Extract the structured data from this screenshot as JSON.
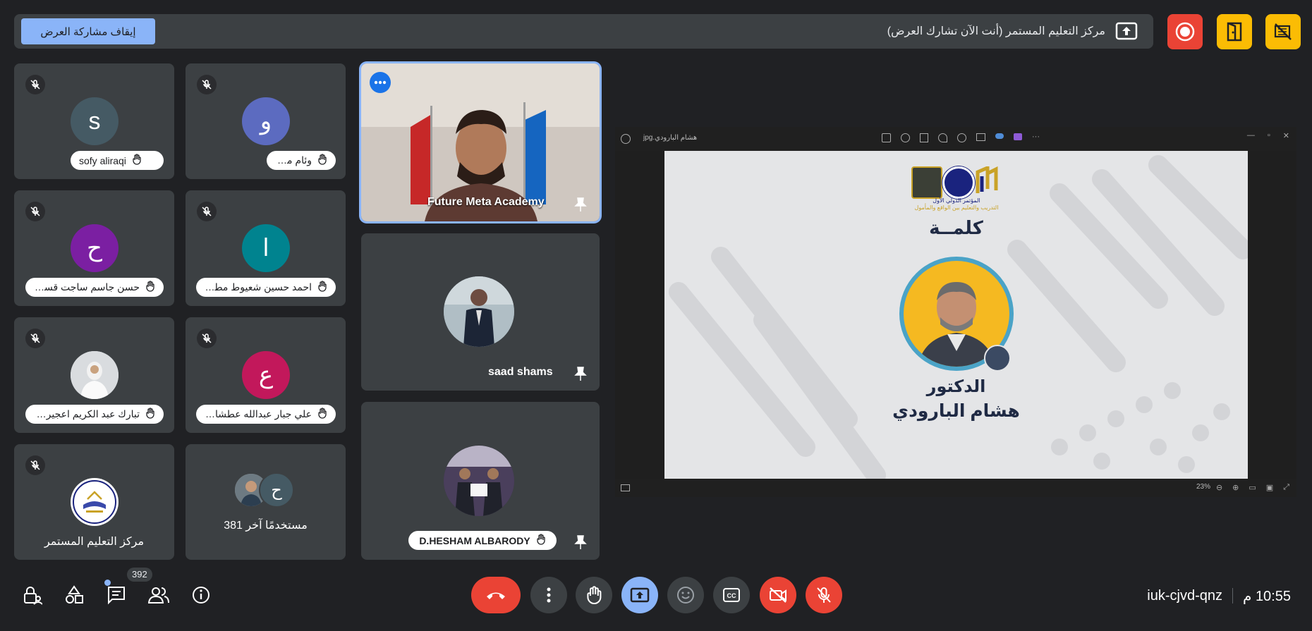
{
  "banner": {
    "stop_share_label": "إيقاف مشاركة العرض",
    "presenting_text": "مركز التعليم المستمر (أنت الآن تشارك العرض)"
  },
  "participants": [
    {
      "name": "sofy aliraqi",
      "initial": "s",
      "color": "#455a64"
    },
    {
      "name": "وئام مراد",
      "initial": "و",
      "color": "#5c6bc0"
    },
    {
      "name": "حسن جاسم ساجت قسم الاد...",
      "initial": "ح",
      "color": "#7b1fa2"
    },
    {
      "name": "احمد حسين شعيوط مطرود ...",
      "initial": "ا",
      "color": "#00838f"
    },
    {
      "name": "تبارك عبد الكريم اعجيري ...",
      "initial": "",
      "color": "#9e9e9e"
    },
    {
      "name": "علي جبار عبدالله عطشان ...",
      "initial": "ع",
      "color": "#c2185b"
    },
    {
      "name": "مركز التعليم المستمر",
      "initial": "",
      "color": "#ffffff"
    },
    {
      "name": "381 مستخدمًا آخر",
      "initial": "ح",
      "color": "#455a64"
    }
  ],
  "featured": [
    {
      "name": "Future Meta Academy"
    },
    {
      "name": "saad shams"
    },
    {
      "name": "D.HESHAM ALBARODY"
    }
  ],
  "presentation": {
    "window_title": "هشام البارودي.jpg",
    "zoom": "23%",
    "slide_heading": "كلمــة",
    "speaker_title": "الدكتور",
    "speaker_name": "هشام البارودي",
    "conference_caption": "المؤتمر الدولي الأول",
    "conference_subtitle": "التدريب والتعليم بين الواقع والمأمول"
  },
  "controls": {
    "chat_badge": "392"
  },
  "meeting": {
    "time": "10:55 م",
    "code": "iuk-cjvd-qnz"
  },
  "colors": {
    "background": "#202124",
    "tile": "#3c4043",
    "accent_blue": "#8ab4f8",
    "danger_red": "#ea4335",
    "warning_yellow": "#fbbc04"
  }
}
